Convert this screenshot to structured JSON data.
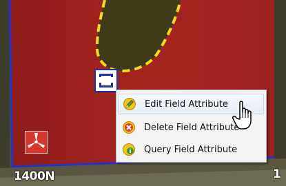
{
  "map": {
    "road_label_left": "1400N",
    "road_label_right": "1",
    "field_color": "#a0221f",
    "boundary_color": "#2233cc",
    "dashed_outline_color": "#f2dc18"
  },
  "context_menu": {
    "items": [
      {
        "label": "Edit Field Attribute",
        "icon": "pencil-edit-icon"
      },
      {
        "label": "Delete Field Attribute",
        "icon": "delete-x-icon"
      },
      {
        "label": "Query Field Attribute",
        "icon": "info-query-icon"
      }
    ]
  },
  "icons": {
    "selection_handle": "selection-square-icon",
    "windmill": "windmill-icon",
    "cursor": "hand-pointer-cursor"
  }
}
